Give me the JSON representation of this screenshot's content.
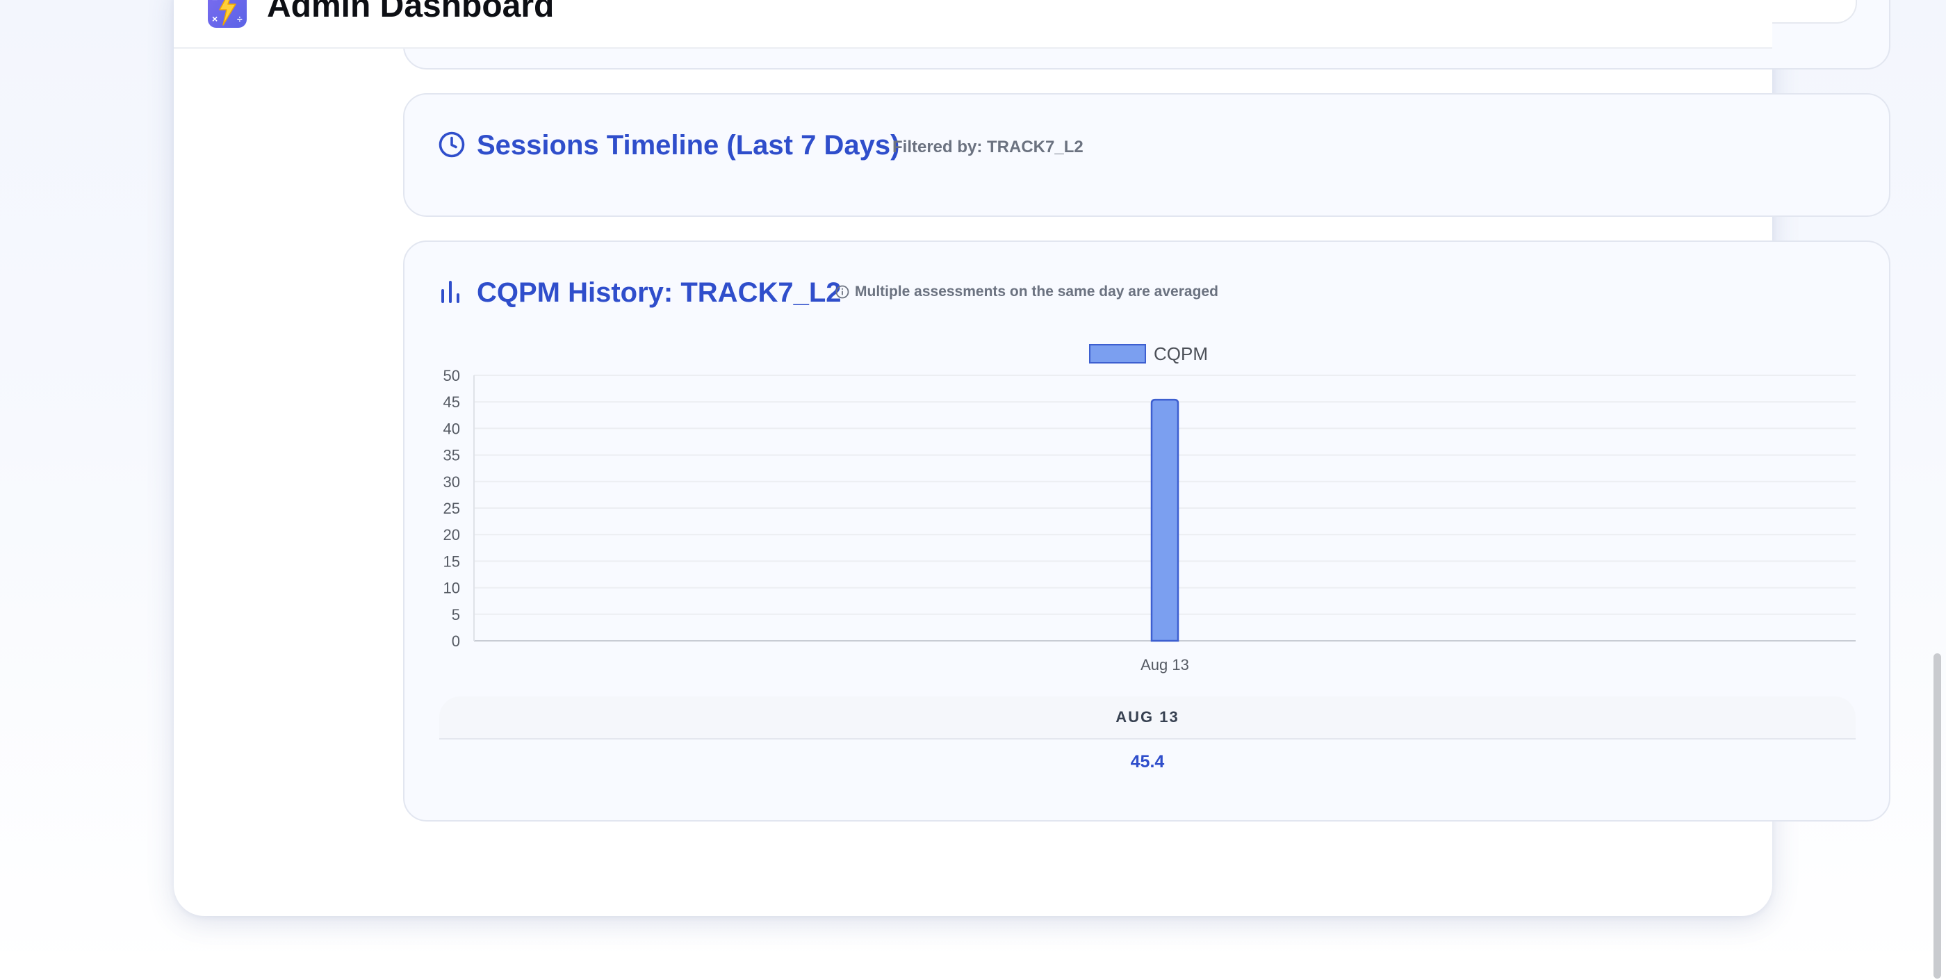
{
  "header": {
    "title": "Admin Dashboard",
    "logo_icon": "lightning-math-logo"
  },
  "sessions": {
    "title": "Sessions Timeline (Last 7 Days)",
    "filter_label": "Filtered by: TRACK7_L2",
    "icon": "clock-icon"
  },
  "cqpm": {
    "title": "CQPM History: TRACK7_L2",
    "icon": "bar-chart-icon",
    "note_icon": "info-icon",
    "note": "Multiple assessments on the same day are averaged"
  },
  "chart_data": {
    "type": "bar",
    "categories": [
      "Aug 13"
    ],
    "series": [
      {
        "name": "CQPM",
        "values": [
          45.4
        ]
      }
    ],
    "y_ticks": [
      "0",
      "5",
      "10",
      "15",
      "20",
      "25",
      "30",
      "35",
      "40",
      "45",
      "50"
    ],
    "ylim": [
      0,
      50
    ],
    "grid": true,
    "legend": "top-center",
    "bar_color": "#7b9ff0",
    "bar_border_color": "#3d5fd0"
  },
  "table": {
    "columns": [
      "AUG 13"
    ],
    "rows": [
      [
        "45.4"
      ]
    ]
  },
  "colors": {
    "accent": "#2f4ecb",
    "muted_text": "#6b7280",
    "card_bg": "#f8faff"
  }
}
